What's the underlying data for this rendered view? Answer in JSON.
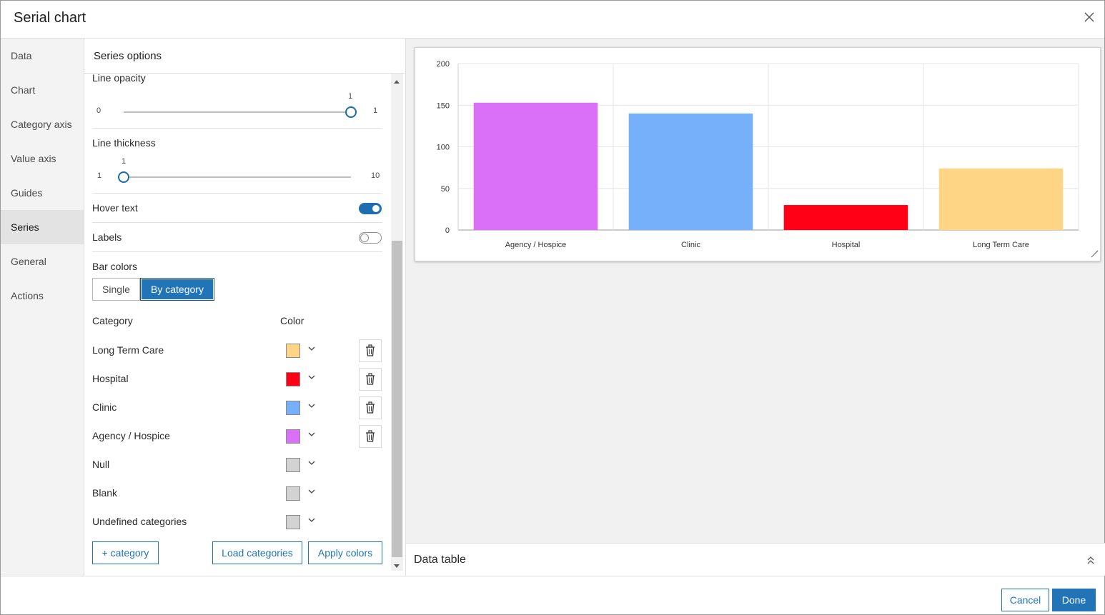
{
  "dialog": {
    "title": "Serial chart",
    "close_icon": "close-icon"
  },
  "nav": {
    "items": [
      "Data",
      "Chart",
      "Category axis",
      "Value axis",
      "Guides",
      "Series",
      "General",
      "Actions"
    ],
    "active": "Series"
  },
  "options": {
    "header": "Series options",
    "line_opacity": {
      "label": "Line opacity",
      "min": "0",
      "max": "1",
      "value": "1",
      "fraction": 1.0
    },
    "line_thickness": {
      "label": "Line thickness",
      "min": "1",
      "max": "10",
      "value": "1",
      "fraction": 0.0
    },
    "hover_text": {
      "label": "Hover text",
      "on": true
    },
    "labels": {
      "label": "Labels",
      "on": false
    },
    "bar_colors": {
      "label": "Bar colors",
      "single": "Single",
      "by_category": "By category",
      "selected": "By category"
    },
    "table": {
      "category_header": "Category",
      "color_header": "Color"
    },
    "categories": [
      {
        "name": "Long Term Care",
        "color": "#fdd584",
        "deletable": true
      },
      {
        "name": "Hospital",
        "color": "#ff0016",
        "deletable": true
      },
      {
        "name": "Clinic",
        "color": "#76b0fa",
        "deletable": true
      },
      {
        "name": "Agency / Hospice",
        "color": "#db70f8",
        "deletable": true
      },
      {
        "name": "Null",
        "color": "#d3d3d3",
        "deletable": false
      },
      {
        "name": "Blank",
        "color": "#d3d3d3",
        "deletable": false
      },
      {
        "name": "Undefined categories",
        "color": "#d3d3d3",
        "deletable": false
      }
    ],
    "buttons": {
      "add_category": "+ category",
      "load_categories": "Load categories",
      "apply_colors": "Apply colors"
    }
  },
  "chart_data": {
    "type": "bar",
    "categories": [
      "Agency / Hospice",
      "Clinic",
      "Hospital",
      "Long Term Care"
    ],
    "values": [
      153,
      140,
      30,
      74
    ],
    "colors": [
      "#db70f8",
      "#76b0fa",
      "#ff0016",
      "#fdd584"
    ],
    "title": "",
    "xlabel": "",
    "ylabel": "",
    "ylim": [
      0,
      200
    ],
    "yticks": [
      "0",
      "50",
      "100",
      "150",
      "200"
    ],
    "grid": true
  },
  "data_table": {
    "label": "Data table"
  },
  "footer": {
    "cancel": "Cancel",
    "done": "Done"
  }
}
